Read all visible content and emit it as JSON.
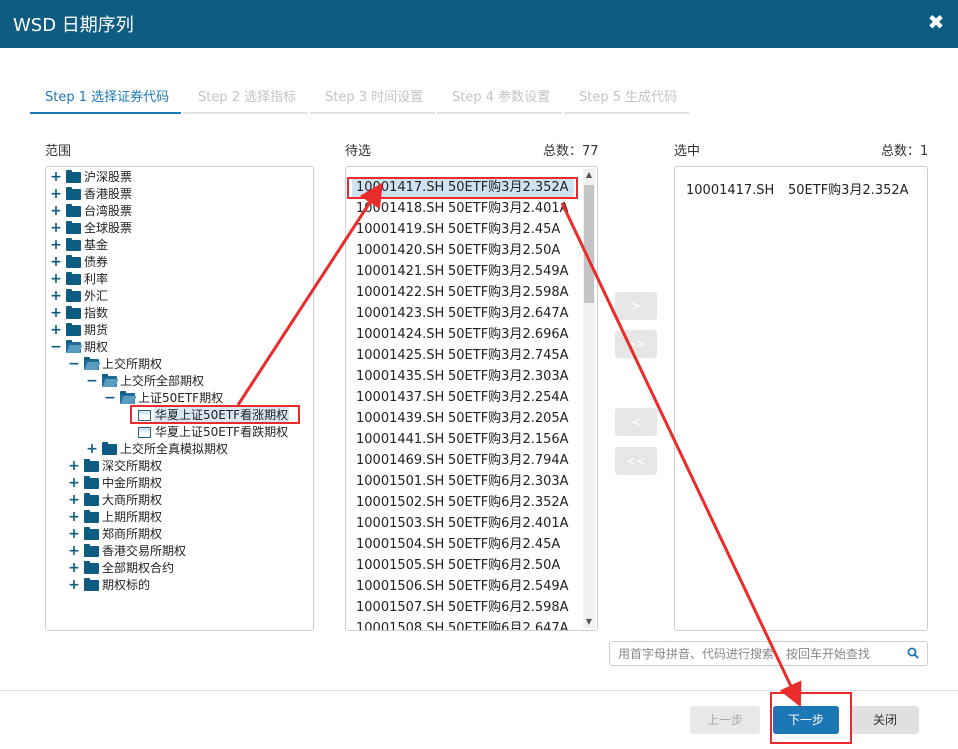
{
  "window": {
    "title": "WSD 日期序列",
    "close_glyph": "✖"
  },
  "steps": [
    {
      "label": "Step 1 选择证券代码"
    },
    {
      "label": "Step 2 选择指标"
    },
    {
      "label": "Step 3 时间设置"
    },
    {
      "label": "Step 4 参数设置"
    },
    {
      "label": "Step 5 生成代码"
    }
  ],
  "scope": {
    "label": "范围",
    "tree": [
      {
        "toggle": "+",
        "label": "沪深股票",
        "icon": "folder-icon"
      },
      {
        "toggle": "+",
        "label": "香港股票",
        "icon": "folder-icon"
      },
      {
        "toggle": "+",
        "label": "台湾股票",
        "icon": "folder-icon"
      },
      {
        "toggle": "+",
        "label": "全球股票",
        "icon": "folder-icon"
      },
      {
        "toggle": "+",
        "label": "基金",
        "icon": "folder-icon"
      },
      {
        "toggle": "+",
        "label": "债券",
        "icon": "folder-icon"
      },
      {
        "toggle": "+",
        "label": "利率",
        "icon": "folder-icon"
      },
      {
        "toggle": "+",
        "label": "外汇",
        "icon": "folder-icon"
      },
      {
        "toggle": "+",
        "label": "指数",
        "icon": "folder-icon"
      },
      {
        "toggle": "+",
        "label": "期货",
        "icon": "folder-icon"
      },
      {
        "toggle": "−",
        "label": "期权",
        "icon": "folder-open-icon"
      },
      {
        "toggle": "−",
        "label": "上交所期权",
        "icon": "folder-open-icon"
      },
      {
        "toggle": "−",
        "label": "上交所全部期权",
        "icon": "folder-open-icon"
      },
      {
        "toggle": "−",
        "label": "上证50ETF期权",
        "icon": "folder-open-icon"
      },
      {
        "toggle": "",
        "label": "华夏上证50ETF看涨期权",
        "icon": "table-icon",
        "selected": true
      },
      {
        "toggle": "",
        "label": "华夏上证50ETF看跌期权",
        "icon": "table-icon"
      },
      {
        "toggle": "+",
        "label": "上交所全真模拟期权",
        "icon": "folder-icon"
      },
      {
        "toggle": "+",
        "label": "深交所期权",
        "icon": "folder-icon"
      },
      {
        "toggle": "+",
        "label": "中金所期权",
        "icon": "folder-icon"
      },
      {
        "toggle": "+",
        "label": "大商所期权",
        "icon": "folder-icon"
      },
      {
        "toggle": "+",
        "label": "上期所期权",
        "icon": "folder-icon"
      },
      {
        "toggle": "+",
        "label": "郑商所期权",
        "icon": "folder-icon"
      },
      {
        "toggle": "+",
        "label": "香港交易所期权",
        "icon": "folder-icon"
      },
      {
        "toggle": "+",
        "label": "全部期权合约",
        "icon": "folder-icon"
      },
      {
        "toggle": "+",
        "label": "期权标的",
        "icon": "folder-icon"
      }
    ]
  },
  "candidates": {
    "label": "待选",
    "total_label": "总数：77",
    "items": [
      {
        "code": "10001417.SH",
        "name": "50ETF购3月2.352A",
        "selected": true
      },
      {
        "code": "10001418.SH",
        "name": "50ETF购3月2.401A"
      },
      {
        "code": "10001419.SH",
        "name": "50ETF购3月2.45A"
      },
      {
        "code": "10001420.SH",
        "name": "50ETF购3月2.50A"
      },
      {
        "code": "10001421.SH",
        "name": "50ETF购3月2.549A"
      },
      {
        "code": "10001422.SH",
        "name": "50ETF购3月2.598A"
      },
      {
        "code": "10001423.SH",
        "name": "50ETF购3月2.647A"
      },
      {
        "code": "10001424.SH",
        "name": "50ETF购3月2.696A"
      },
      {
        "code": "10001425.SH",
        "name": "50ETF购3月2.745A"
      },
      {
        "code": "10001435.SH",
        "name": "50ETF购3月2.303A"
      },
      {
        "code": "10001437.SH",
        "name": "50ETF购3月2.254A"
      },
      {
        "code": "10001439.SH",
        "name": "50ETF购3月2.205A"
      },
      {
        "code": "10001441.SH",
        "name": "50ETF购3月2.156A"
      },
      {
        "code": "10001469.SH",
        "name": "50ETF购3月2.794A"
      },
      {
        "code": "10001501.SH",
        "name": "50ETF购6月2.303A"
      },
      {
        "code": "10001502.SH",
        "name": "50ETF购6月2.352A"
      },
      {
        "code": "10001503.SH",
        "name": "50ETF购6月2.401A"
      },
      {
        "code": "10001504.SH",
        "name": "50ETF购6月2.45A"
      },
      {
        "code": "10001505.SH",
        "name": "50ETF购6月2.50A"
      },
      {
        "code": "10001506.SH",
        "name": "50ETF购6月2.549A"
      },
      {
        "code": "10001507.SH",
        "name": "50ETF购6月2.598A"
      },
      {
        "code": "10001508.SH",
        "name": "50ETF购6月2.647A"
      }
    ]
  },
  "selected_panel": {
    "label": "选中",
    "total_label": "总数：1",
    "items": [
      {
        "code": "10001417.SH",
        "name": "50ETF购3月2.352A"
      }
    ]
  },
  "move_buttons": {
    "add": ">",
    "add_all": ">>",
    "remove": "<",
    "remove_all": "<<"
  },
  "search": {
    "placeholder": "用首字母拼音、代码进行搜索，按回车开始查找",
    "icon": "search-icon"
  },
  "footer": {
    "prev_label": "上一步",
    "next_label": "下一步",
    "close_label": "关闭"
  },
  "colors": {
    "titlebar": "#0e5c82",
    "accent": "#1b78b4",
    "annotation": "#ea2b2b"
  }
}
